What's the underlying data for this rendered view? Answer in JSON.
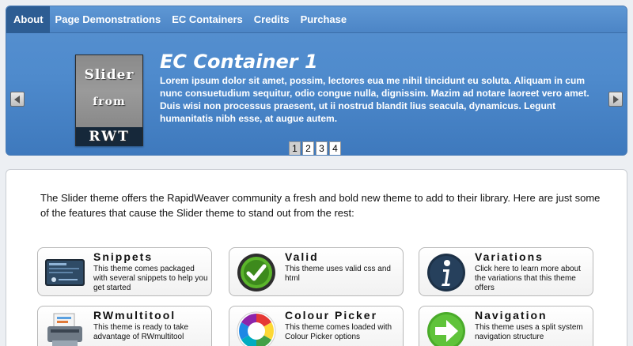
{
  "nav": {
    "items": [
      {
        "label": "About"
      },
      {
        "label": "Page Demonstrations"
      },
      {
        "label": "EC Containers"
      },
      {
        "label": "Credits"
      },
      {
        "label": "Purchase"
      }
    ]
  },
  "slider": {
    "logo_line1": "Slider",
    "logo_line2": "from",
    "logo_line3": "RWT",
    "title": "EC Container 1",
    "body": "Lorem ipsum dolor sit amet, possim, lectores eua me nihil tincidunt eu soluta. Aliquam in cum nunc consuetudium sequitur, odio congue nulla, dignissim. Mazim ad notare laoreet vero amet. Duis wisi non processus praesent, ut ii nostrud blandit lius seacula, dynamicus. Legunt humanitatis nibh esse, at augue autem.",
    "pages": [
      "1",
      "2",
      "3",
      "4"
    ],
    "current_page": "1"
  },
  "content": {
    "intro": "The Slider theme offers the RapidWeaver community a fresh and bold new theme to add to their library. Here are just some of the features that cause the Slider theme to stand out from the rest:",
    "features": [
      {
        "title": "Snippets",
        "desc": "This theme comes packaged with several snippets to help you get started",
        "icon": "snippets-screenshot-icon"
      },
      {
        "title": "Valid",
        "desc": "This theme uses valid css and html",
        "icon": "checkmark-badge-icon"
      },
      {
        "title": "Variations",
        "desc": "Click here to learn more about the variations that this theme offers",
        "icon": "info-icon"
      },
      {
        "title": "RWmultitool",
        "desc": "This theme is ready to take advantage of RWmultitool",
        "icon": "multitool-printer-icon"
      },
      {
        "title": "Colour Picker",
        "desc": "This theme comes loaded with Colour Picker options",
        "icon": "color-wheel-icon"
      },
      {
        "title": "Navigation",
        "desc": "This theme uses a split system navigation structure",
        "icon": "arrow-right-circle-icon"
      }
    ]
  },
  "colors": {
    "header_blue": "#4f8bcd",
    "nav_active": "#2d5d93",
    "valid_green": "#5bb52b",
    "nav_icon_green": "#4aab2a",
    "info_dark": "#1d3147"
  }
}
